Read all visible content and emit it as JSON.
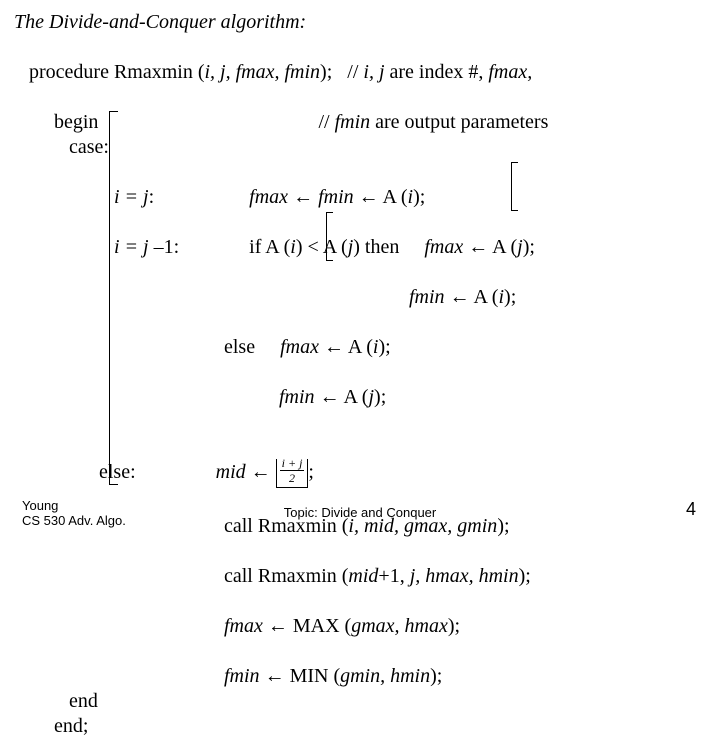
{
  "title": "The Divide-and-Conquer algorithm:",
  "proc_line": {
    "kw": "procedure",
    "sig": " Rmaxmin (",
    "args": "i, j, fmax, fmin",
    "close": ");",
    "cmt_pre": "   // ",
    "cmt_it1": "i, j",
    "cmt_mid": " are index #, ",
    "cmt_it2": "fmax,"
  },
  "begin_line": {
    "kw": "        begin",
    "cmt_pre": "                                            // ",
    "cmt_it": "fmin",
    "cmt_end": " are output parameters"
  },
  "case_kw": "           case:",
  "c1": {
    "lhs_pre": "                    ",
    "lhs": "i = j",
    "colon": ":                   ",
    "r1a": "fmax",
    "r1b": " ← ",
    "r1c": "fmin",
    "r1d": " ← A (",
    "r1e": "i",
    "r1f": ");"
  },
  "c2": {
    "lhs_pre": "                    ",
    "lhs": "i = j ",
    "minus": "–",
    "one": "1:              ",
    "r": "if A (",
    "ri": "i",
    "rmid": ") < A (",
    "rj": "j",
    "rend": ") then     ",
    "t1a": "fmax",
    "t1b": " ← A (",
    "t1c": "j",
    "t1d": ");"
  },
  "c2b": {
    "pad": "                                                                               ",
    "a": "fmin",
    "b": " ← A (",
    "c": "i",
    "d": ");"
  },
  "c2else": {
    "pad": "                                          else     ",
    "a": "fmax",
    "b": " ← A (",
    "c": "i",
    "d": ");"
  },
  "c2else2": {
    "pad": "                                                     ",
    "a": "fmin",
    "b": " ← A (",
    "c": "j",
    "d": ");"
  },
  "elsecase": {
    "pad": "                 else:                ",
    "a": "mid",
    "b": " ← ",
    "frac_num": "i + j",
    "frac_den": "2",
    "semi": ";"
  },
  "call1": {
    "pad": "                                          call Rmaxmin (",
    "a": "i, mid, gmax, gmin",
    "end": ");"
  },
  "call2": {
    "pad": "                                          call Rmaxmin (",
    "a": "mid",
    "plus": "+1, ",
    "b": "j, hmax, hmin",
    "end": ");"
  },
  "fmaxline": {
    "pad": "                                          ",
    "a": "fmax",
    "b": " ← MAX (",
    "c": "gmax, hmax",
    "d": ");"
  },
  "fminline": {
    "pad": "                                          ",
    "a": "fmin",
    "b": " ← MIN (",
    "c": "gmin, hmin",
    "d": ");"
  },
  "end1": "           end",
  "end2": "        end;",
  "footer": {
    "author": "Young",
    "course": "CS 530 Adv. Algo.",
    "topic": "Topic: Divide and Conquer",
    "page": "4"
  }
}
